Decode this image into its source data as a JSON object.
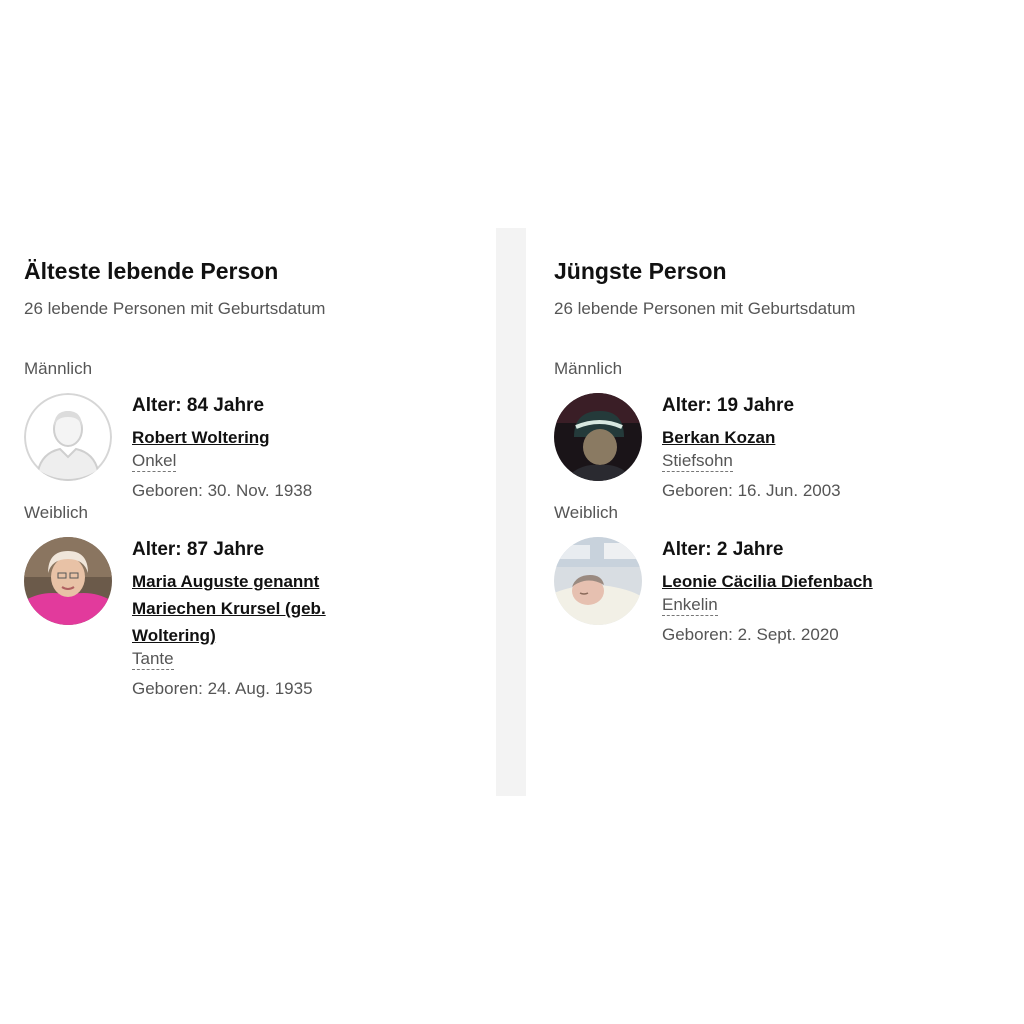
{
  "oldest": {
    "title": "Älteste lebende Person",
    "subtitle": "26 lebende Personen mit Geburtsdatum",
    "male": {
      "section_label": "Männlich",
      "age": "Alter: 84 Jahre",
      "name": "Robert Woltering",
      "relation": "Onkel",
      "born": "Geboren: 30. Nov. 1938",
      "avatar_icon": "default-person-silhouette"
    },
    "female": {
      "section_label": "Weiblich",
      "age": "Alter: 87 Jahre",
      "name": "Maria Auguste genannt Mariechen Krursel (geb. Woltering)",
      "relation": "Tante",
      "born": "Geboren: 24. Aug. 1935",
      "avatar_icon": "photo-woman"
    }
  },
  "youngest": {
    "title": "Jüngste Person",
    "subtitle": "26 lebende Personen mit Geburtsdatum",
    "male": {
      "section_label": "Männlich",
      "age": "Alter: 19 Jahre",
      "name": "Berkan Kozan",
      "relation": "Stiefsohn",
      "born": "Geboren: 16. Jun. 2003",
      "avatar_icon": "photo-boy"
    },
    "female": {
      "section_label": "Weiblich",
      "age": "Alter: 2 Jahre",
      "name": "Leonie Cäcilia Diefenbach",
      "relation": "Enkelin",
      "born": "Geboren: 2. Sept. 2020",
      "avatar_icon": "photo-baby"
    }
  }
}
